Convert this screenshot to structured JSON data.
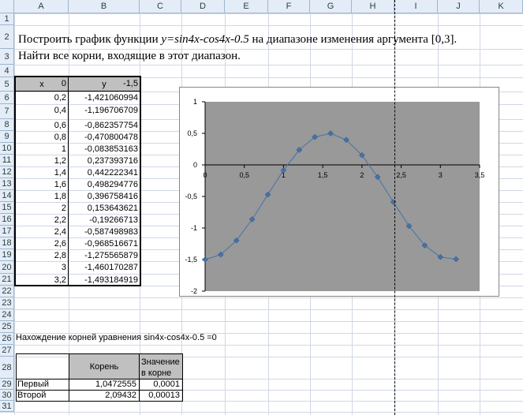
{
  "columns": [
    "A",
    "B",
    "C",
    "D",
    "E",
    "F",
    "G",
    "H",
    "I",
    "J",
    "K"
  ],
  "rows": [
    "1",
    "2",
    "3",
    "4",
    "5",
    "6",
    "7",
    "8",
    "9",
    "10",
    "11",
    "12",
    "13",
    "14",
    "15",
    "16",
    "17",
    "18",
    "19",
    "20",
    "21",
    "22",
    "23",
    "24",
    "25",
    "26",
    "27",
    "28",
    "29",
    "30",
    "31"
  ],
  "task": {
    "line1_prefix": "Построить график функции  ",
    "line1_func": "y=sin4x-cos4x-0.5",
    "line1_suffix": "  на  диапазоне изменения аргумента   [0,3].",
    "line2": "Найти все корни, входящие в этот диапазон."
  },
  "table": {
    "header_x": "x",
    "header_y": "y",
    "rows": [
      {
        "x": "0",
        "y": "-1,5"
      },
      {
        "x": "0,2",
        "y": "-1,421060994"
      },
      {
        "x": "0,4",
        "y": "-1,196706709"
      },
      {
        "x": "0,6",
        "y": "-0,862357754"
      },
      {
        "x": "0,8",
        "y": "-0,470800478"
      },
      {
        "x": "1",
        "y": "-0,083853163"
      },
      {
        "x": "1,2",
        "y": "0,237393716"
      },
      {
        "x": "1,4",
        "y": "0,442222341"
      },
      {
        "x": "1,6",
        "y": "0,498294776"
      },
      {
        "x": "1,8",
        "y": "0,396758416"
      },
      {
        "x": "2",
        "y": "0,153643621"
      },
      {
        "x": "2,2",
        "y": "-0,19266713"
      },
      {
        "x": "2,4",
        "y": "-0,587498983"
      },
      {
        "x": "2,6",
        "y": "-0,968516671"
      },
      {
        "x": "2,8",
        "y": "-1,275565879"
      },
      {
        "x": "3",
        "y": "-1,460170287"
      },
      {
        "x": "3,2",
        "y": "-1,493184919"
      }
    ]
  },
  "roots": {
    "title": "Нахождение корней уравнения sin4x-cos4x-0.5 =0",
    "header_root": "Корень",
    "header_value_1": "Значение",
    "header_value_2": "в корне",
    "rows": [
      {
        "label": "Первый",
        "root": "1,0472555",
        "value": "0,0001"
      },
      {
        "label": "Второй",
        "root": "2,09432",
        "value": "0,00013"
      }
    ]
  },
  "colors": {
    "plot_area": "#999999",
    "series": "#4572a7",
    "header_bg": "#e4ecf7",
    "roots_header_bg": "#c0c0c0"
  },
  "chart_data": {
    "type": "scatter",
    "line": true,
    "x": [
      0,
      0.2,
      0.4,
      0.6,
      0.8,
      1,
      1.2,
      1.4,
      1.6,
      1.8,
      2,
      2.2,
      2.4,
      2.6,
      2.8,
      3,
      3.2
    ],
    "y": [
      -1.5,
      -1.421060994,
      -1.196706709,
      -0.862357754,
      -0.470800478,
      -0.083853163,
      0.237393716,
      0.442222341,
      0.498294776,
      0.396758416,
      0.153643621,
      -0.19266713,
      -0.587498983,
      -0.968516671,
      -1.275565879,
      -1.460170287,
      -1.493184919
    ],
    "xlim": [
      0,
      3.5
    ],
    "ylim": [
      -2,
      1
    ],
    "xticks": [
      "0",
      "0,5",
      "1",
      "1,5",
      "2",
      "2,5",
      "3",
      "3,5"
    ],
    "yticks": [
      "1",
      "0,5",
      "0",
      "-0,5",
      "-1",
      "-1,5",
      "-2"
    ],
    "grid": false,
    "legend": "none"
  }
}
